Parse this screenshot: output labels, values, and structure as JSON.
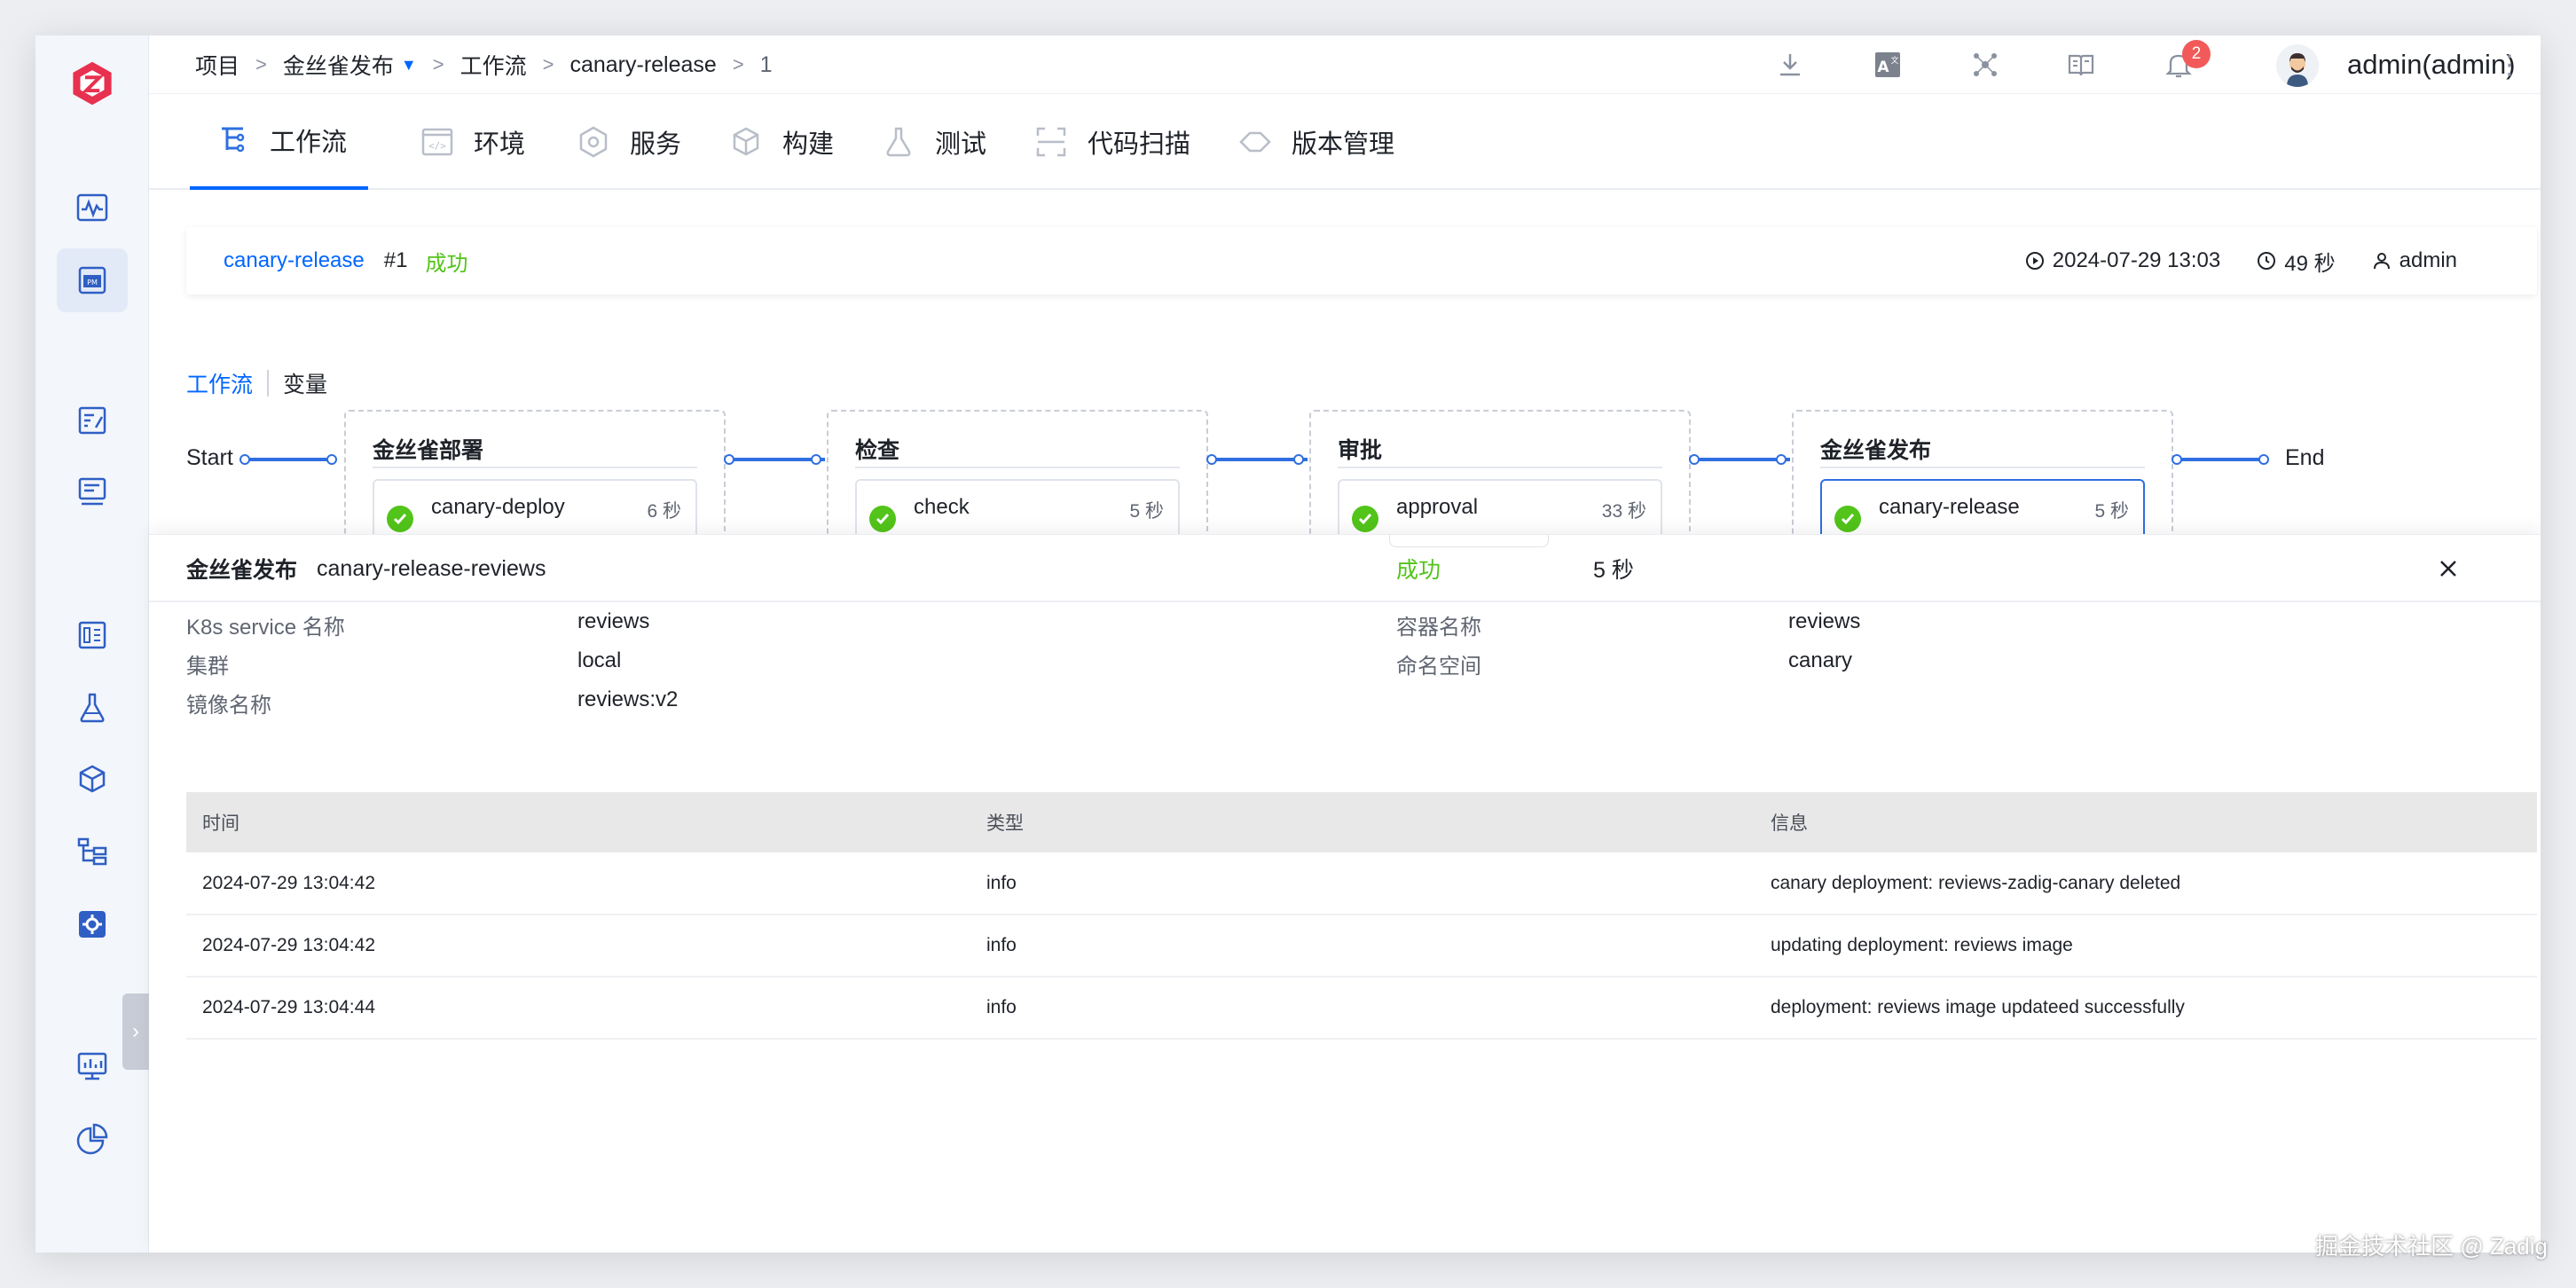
{
  "breadcrumb": {
    "project": "项目",
    "project_name": "金丝雀发布",
    "workflows": "工作流",
    "workflow_name": "canary-release",
    "run": "1",
    "separator": ">"
  },
  "header": {
    "notification_count": "2",
    "username": "admin(admin)"
  },
  "nav_tabs": [
    "工作流",
    "环境",
    "服务",
    "构建",
    "测试",
    "代码扫描",
    "版本管理"
  ],
  "summary": {
    "workflow": "canary-release",
    "run_number": "#1",
    "status": "成功",
    "start_time": "2024-07-29 13:03",
    "duration": "49 秒",
    "creator": "admin"
  },
  "subtabs": {
    "workflow": "工作流",
    "variables": "变量"
  },
  "pipeline": {
    "start": "Start",
    "end": "End",
    "stages": [
      {
        "title": "金丝雀部署",
        "job": "canary-deploy",
        "duration": "6 秒"
      },
      {
        "title": "检查",
        "job": "check",
        "duration": "5 秒"
      },
      {
        "title": "审批",
        "job": "approval",
        "duration": "33 秒"
      },
      {
        "title": "金丝雀发布",
        "job": "canary-release",
        "duration": "5 秒"
      }
    ]
  },
  "drawer": {
    "stage": "金丝雀发布",
    "job": "canary-release-reviews",
    "status": "成功",
    "duration": "5 秒",
    "fields": {
      "service_label": "K8s service 名称",
      "service_value": "reviews",
      "container_label": "容器名称",
      "container_value": "reviews",
      "cluster_label": "集群",
      "cluster_value": "local",
      "namespace_label": "命名空间",
      "namespace_value": "canary",
      "image_label": "镜像名称",
      "image_value": "reviews:v2"
    },
    "table": {
      "headers": [
        "时间",
        "类型",
        "信息"
      ],
      "rows": [
        [
          "2024-07-29 13:04:42",
          "info",
          "canary deployment: reviews-zadig-canary deleted"
        ],
        [
          "2024-07-29 13:04:42",
          "info",
          "updating deployment: reviews image"
        ],
        [
          "2024-07-29 13:04:44",
          "info",
          "deployment: reviews image updateed successfully"
        ]
      ]
    }
  },
  "watermark": "掘金技术社区 @ Zadig",
  "colors": {
    "accent": "#0066ff",
    "success": "#52c41a",
    "logo": "#e8304f",
    "badge": "#f25a5a"
  }
}
